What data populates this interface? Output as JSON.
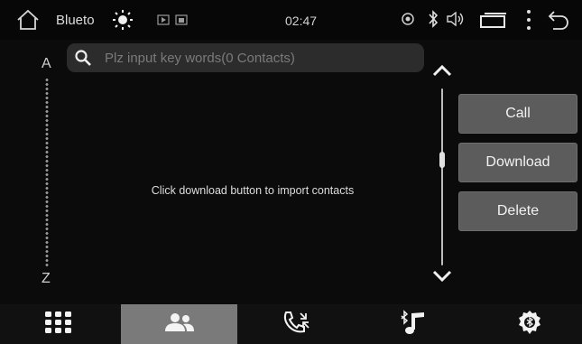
{
  "statusbar": {
    "app_title": "Blueto",
    "time": "02:47"
  },
  "search": {
    "placeholder": "Plz input key words(0 Contacts)",
    "value": ""
  },
  "index_bar": {
    "top_letter": "A",
    "bottom_letter": "Z"
  },
  "content": {
    "empty_message": "Click download button to import contacts"
  },
  "actions": {
    "call_label": "Call",
    "download_label": "Download",
    "delete_label": "Delete"
  },
  "bottom_nav": {
    "tabs": [
      {
        "icon": "dialpad-icon",
        "active": false
      },
      {
        "icon": "contacts-icon",
        "active": true
      },
      {
        "icon": "call-log-icon",
        "active": false
      },
      {
        "icon": "bluetooth-music-icon",
        "active": false
      },
      {
        "icon": "bluetooth-settings-icon",
        "active": false
      }
    ]
  },
  "colors": {
    "background": "#0b0b0b",
    "button": "#5c5c5c",
    "active_tab": "#7a7a7a",
    "search_box": "#2c2c2c"
  }
}
